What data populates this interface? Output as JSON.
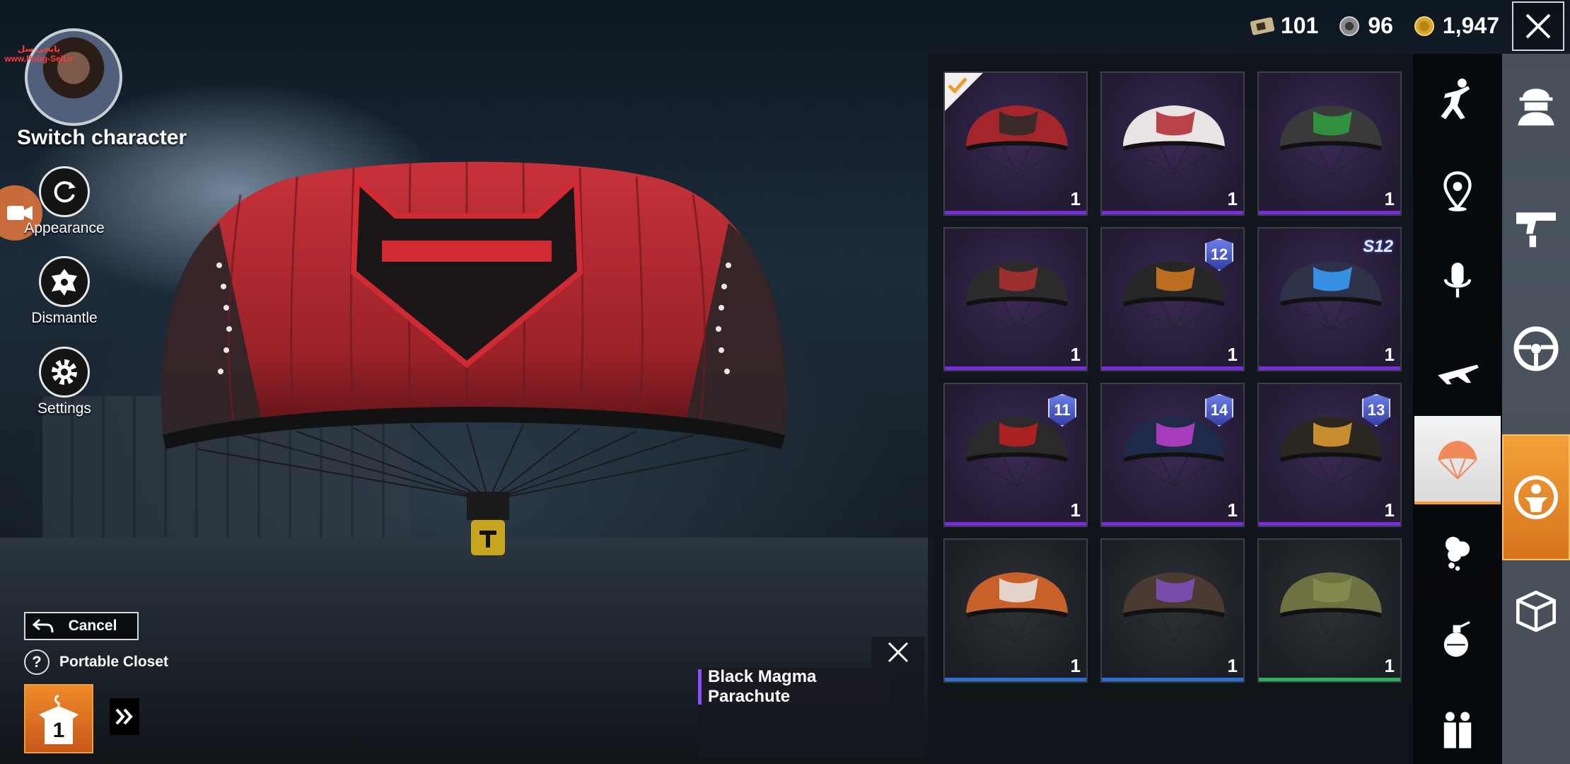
{
  "currency": [
    {
      "icon": "ticket-icon",
      "value": "101"
    },
    {
      "icon": "silver-coin-icon",
      "value": "96"
    },
    {
      "icon": "gold-coin-icon",
      "value": "1,947"
    }
  ],
  "left_panel": {
    "watermark_line1": "پابجی سل",
    "watermark_line2": "www.Pubg-Sell.ir",
    "switch_character": "Switch character",
    "appearance": "Appearance",
    "dismantle": "Dismantle",
    "settings": "Settings",
    "cancel": "Cancel",
    "portable_closet": "Portable Closet",
    "closet_count": "1"
  },
  "tooltip": {
    "item_name": "Black Magma Parachute"
  },
  "items": [
    {
      "qty": "1",
      "rarity": "purple",
      "equipped": true,
      "badge": "",
      "colors": [
        "#a3262b",
        "#2a2a2a"
      ]
    },
    {
      "qty": "1",
      "rarity": "purple",
      "equipped": false,
      "badge": "",
      "colors": [
        "#e8e4e4",
        "#b0262b"
      ]
    },
    {
      "qty": "1",
      "rarity": "purple",
      "equipped": false,
      "badge": "",
      "colors": [
        "#3a3a3a",
        "#30a040"
      ]
    },
    {
      "qty": "1",
      "rarity": "purple",
      "equipped": false,
      "badge": "",
      "colors": [
        "#2c2c2c",
        "#b03030"
      ]
    },
    {
      "qty": "1",
      "rarity": "purple",
      "equipped": false,
      "badge": "12",
      "colors": [
        "#262626",
        "#d87a20"
      ]
    },
    {
      "qty": "1",
      "rarity": "purple",
      "equipped": false,
      "badge": "S12",
      "colors": [
        "#2d3248",
        "#3aa0ff"
      ]
    },
    {
      "qty": "1",
      "rarity": "purple",
      "equipped": false,
      "badge": "11",
      "colors": [
        "#2a2a2a",
        "#c02020"
      ]
    },
    {
      "qty": "1",
      "rarity": "purple",
      "equipped": false,
      "badge": "14",
      "colors": [
        "#1e2a48",
        "#c040d0"
      ]
    },
    {
      "qty": "1",
      "rarity": "purple",
      "equipped": false,
      "badge": "13",
      "colors": [
        "#2a2620",
        "#e0a030"
      ]
    },
    {
      "qty": "1",
      "rarity": "blue",
      "equipped": false,
      "badge": "",
      "colors": [
        "#c8602a",
        "#e8e8e8"
      ]
    },
    {
      "qty": "1",
      "rarity": "blue",
      "equipped": false,
      "badge": "",
      "colors": [
        "#4a3a32",
        "#8050c0"
      ]
    },
    {
      "qty": "1",
      "rarity": "green",
      "equipped": false,
      "badge": "",
      "colors": [
        "#6e7240",
        "#8a8c50"
      ]
    }
  ],
  "categories": [
    {
      "name": "emote"
    },
    {
      "name": "location"
    },
    {
      "name": "voice"
    },
    {
      "name": "plane"
    },
    {
      "name": "parachute",
      "active": true
    },
    {
      "name": "smoke"
    },
    {
      "name": "grenade"
    },
    {
      "name": "team"
    }
  ],
  "rail": [
    {
      "name": "character"
    },
    {
      "name": "weapon"
    },
    {
      "name": "vehicle"
    },
    {
      "name": "lobby",
      "active": true
    },
    {
      "name": "crate"
    }
  ],
  "colors": {
    "purple": "#7a2de0",
    "blue": "#2a6fd6",
    "green": "#2fb05a",
    "accent": "#f39b2b"
  }
}
